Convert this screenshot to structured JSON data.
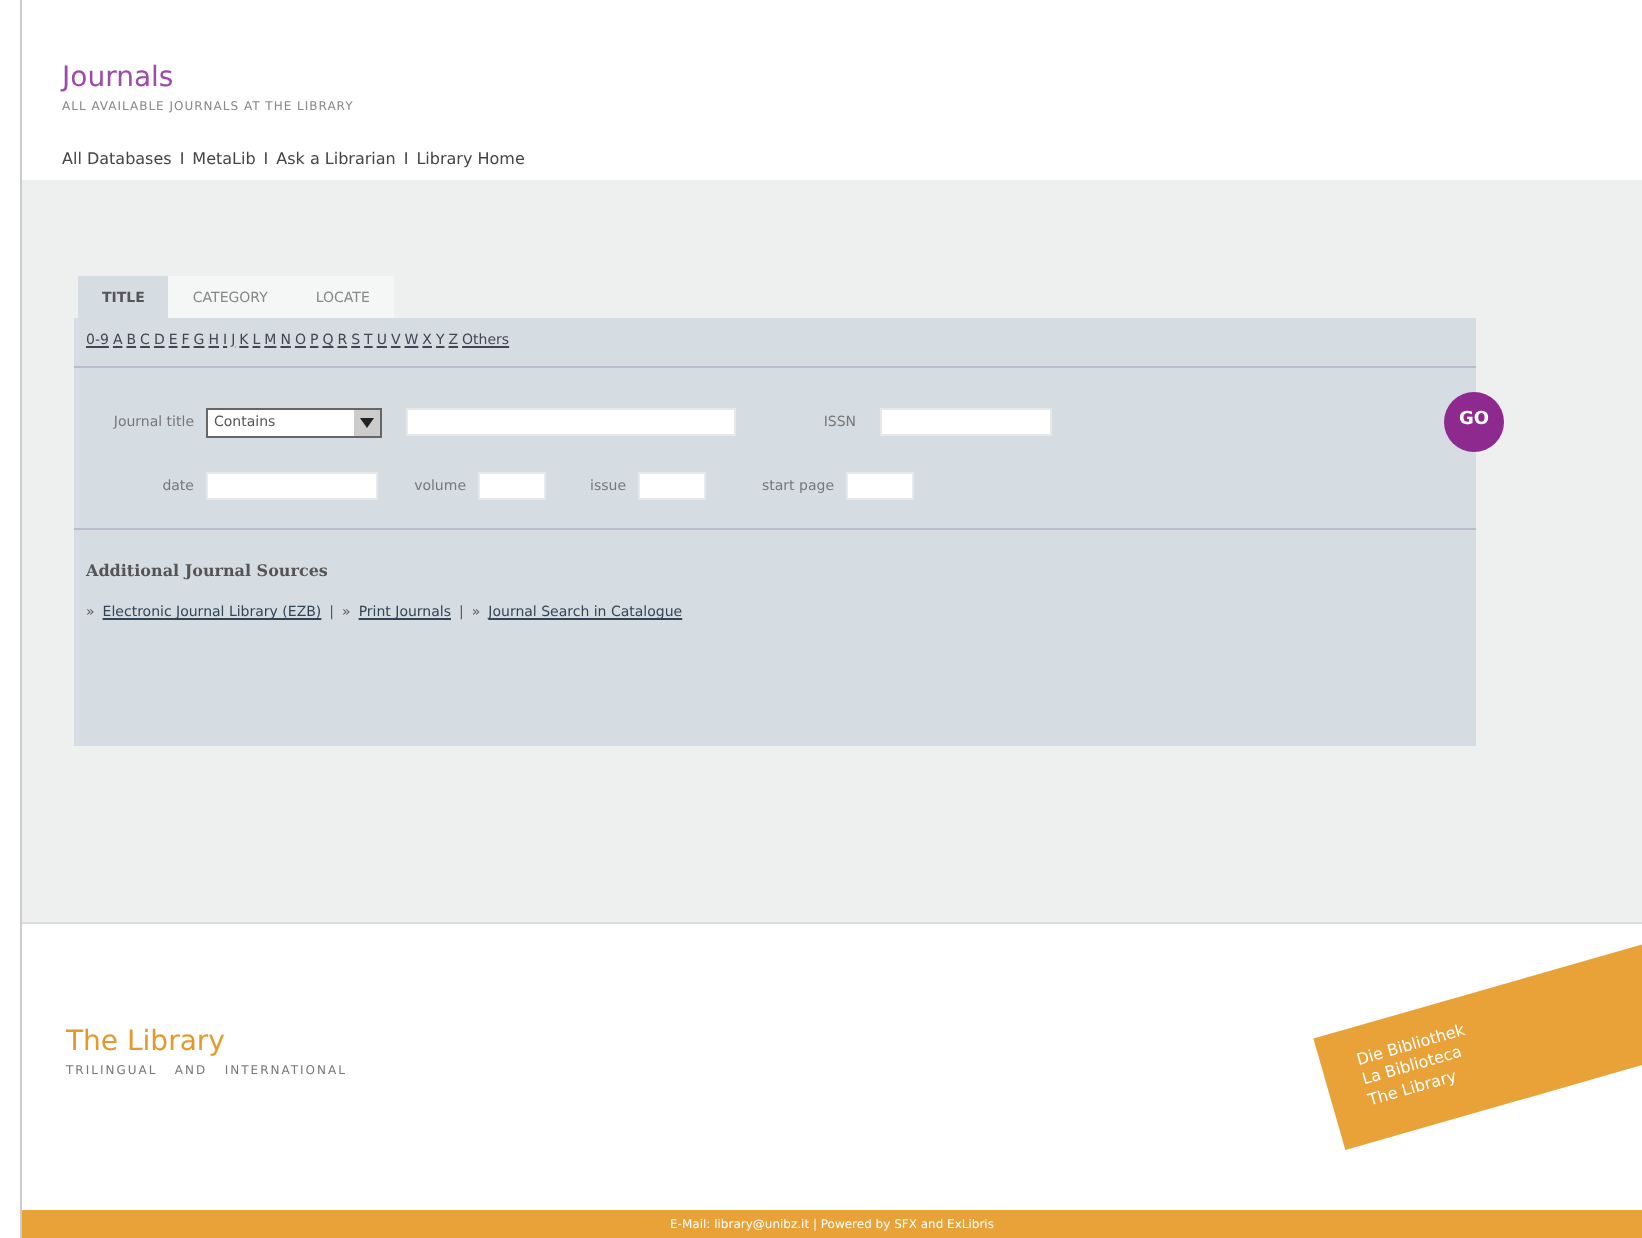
{
  "header": {
    "title": "Journals",
    "subtitle": "ALL AVAILABLE JOURNALS AT THE LIBRARY"
  },
  "nav_links": [
    "All Databases",
    "I",
    "MetaLib",
    "I",
    "Ask a Librarian",
    "I",
    "Library Home"
  ],
  "tabs": [
    {
      "label": "TITLE",
      "selected": true
    },
    {
      "label": "CATEGORY",
      "selected": false
    },
    {
      "label": "LOCATE",
      "selected": false
    }
  ],
  "alphabet": [
    "0-9",
    "A",
    "B",
    "C",
    "D",
    "E",
    "F",
    "G",
    "H",
    "I",
    "J",
    "K",
    "L",
    "M",
    "N",
    "O",
    "P",
    "Q",
    "R",
    "S",
    "T",
    "U",
    "V",
    "W",
    "X",
    "Y",
    "Z",
    "Others"
  ],
  "search": {
    "journal_title_label": "Journal title",
    "match_select": "Contains",
    "issn_label": "ISSN",
    "date_label": "date",
    "volume_label": "volume",
    "issue_label": "issue",
    "start_page_label": "start page",
    "go_button": "GO"
  },
  "additional_sources": {
    "heading": "Additional Journal Sources",
    "links": [
      {
        "kind": "bullet",
        "text": "»"
      },
      {
        "kind": "link",
        "text": "Electronic Journal Library (EZB)"
      },
      {
        "kind": "separator",
        "text": "|"
      },
      {
        "kind": "bullet",
        "text": "»"
      },
      {
        "kind": "link",
        "text": "Print Journals"
      },
      {
        "kind": "separator",
        "text": "|"
      },
      {
        "kind": "bullet",
        "text": "»"
      },
      {
        "kind": "link",
        "text": "Journal Search in Catalogue"
      }
    ]
  },
  "footer": {
    "title": "The Library",
    "subtitle": "TRILINGUAL   AND   INTERNATIONAL",
    "stamp_lines": [
      "Die Bibliothek",
      "La Biblioteca",
      "The Library"
    ],
    "bottom_text": "E-Mail: library@unibz.it | Powered by SFX and ExLibris"
  }
}
